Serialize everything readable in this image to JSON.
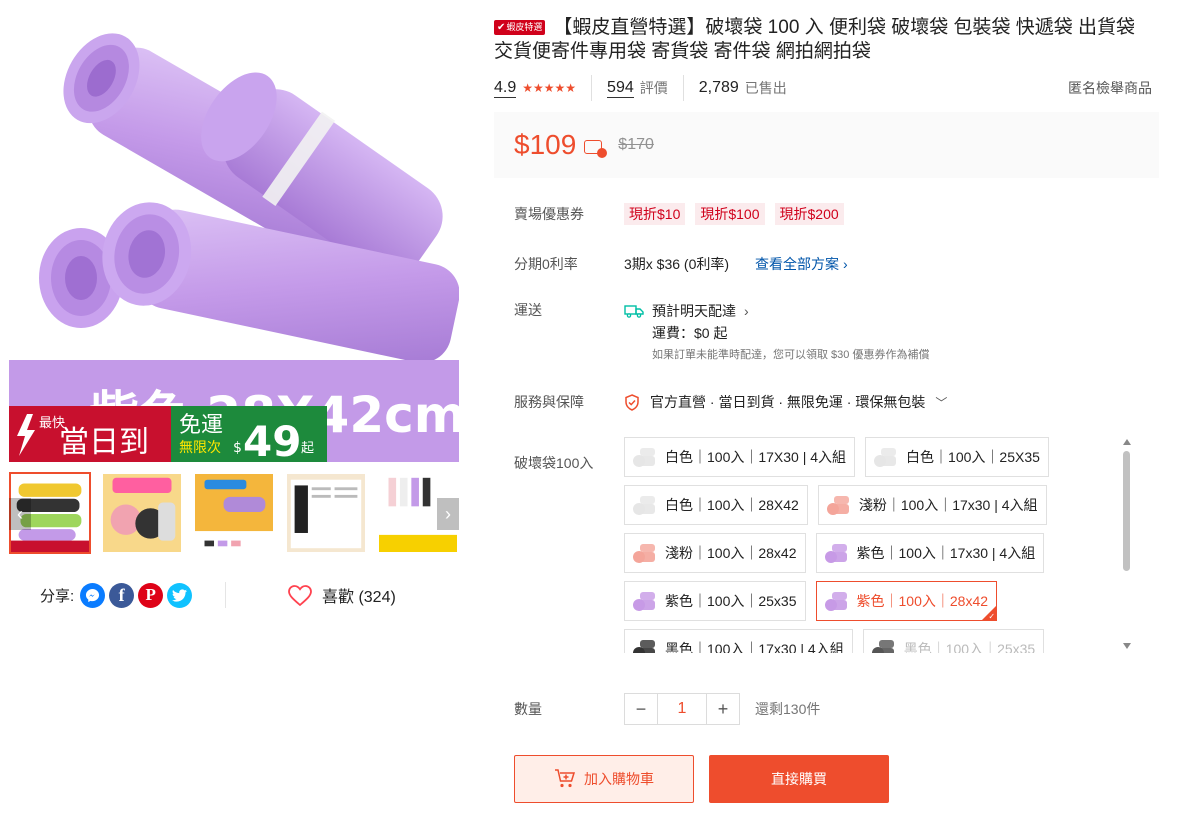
{
  "gallery": {
    "banner_text": "紫色 28X42cm",
    "badge_fastest": "最快",
    "badge_same_day": "當日到",
    "badge_free_ship": "免運",
    "badge_unlimited": "無限次",
    "badge_amount": "49",
    "badge_currency": "$",
    "badge_from": "起",
    "thumb_colors": [
      "#f0c830",
      "#e9a020",
      "#f4b63c",
      "#f5e7d0",
      "#f7d000"
    ],
    "prev_icon": "chevron-left-icon",
    "next_icon": "chevron-right-icon"
  },
  "share": {
    "label": "分享:",
    "icons": [
      "messenger-icon",
      "facebook-icon",
      "pinterest-icon",
      "twitter-icon"
    ]
  },
  "like": {
    "label": "喜歡 (324)",
    "icon": "heart-icon"
  },
  "product": {
    "tag": "蝦皮特選",
    "title": "【蝦皮直營特選】破壞袋 100 入 便利袋 破壞袋 包裝袋 快遞袋 出貨袋 交貨便寄件專用袋 寄貨袋 寄件袋 網拍網拍袋",
    "rating": "4.9",
    "stars": "★★★★★",
    "reviews_count": "594",
    "reviews_label": "評價",
    "sold_count": "2,789",
    "sold_label": "已售出",
    "report_label": "匿名檢舉商品"
  },
  "price": {
    "current": "$109",
    "original": "$170"
  },
  "vouchers": {
    "label": "賣場優惠券",
    "items": [
      "現折$10",
      "現折$100",
      "現折$200"
    ]
  },
  "installment": {
    "label": "分期0利率",
    "text": "3期x $36 (0利率)",
    "link": "查看全部方案"
  },
  "shipping": {
    "label": "運送",
    "eta": "預計明天配達",
    "fee": "運費：$0 起",
    "note": "如果訂單未能準時配達，您可以領取 $30 優惠券作為補償"
  },
  "service": {
    "label": "服務與保障",
    "text": "官方直營 · 當日到貨 · 無限免運 · 環保無包裝"
  },
  "variants": {
    "label": "破壞袋100入",
    "options": [
      {
        "label": "白色｜100入｜17X30 | 4入組",
        "color": "#e6e6e6"
      },
      {
        "label": "白色｜100入｜25X35",
        "color": "#e6e6e6"
      },
      {
        "label": "白色｜100入｜28X42",
        "color": "#e6e6e6"
      },
      {
        "label": "淺粉｜100入｜17x30 | 4入組",
        "color": "#f4a59a"
      },
      {
        "label": "淺粉｜100入｜28x42",
        "color": "#f4a59a"
      },
      {
        "label": "紫色｜100入｜17x30 | 4入組",
        "color": "#c79ae6"
      },
      {
        "label": "紫色｜100入｜25x35",
        "color": "#c79ae6"
      },
      {
        "label": "紫色｜100入｜28x42",
        "color": "#c79ae6"
      },
      {
        "label": "黑色｜100入｜17x30 | 4入組",
        "color": "#333333"
      },
      {
        "label": "黑色｜100入｜25x35",
        "color": "#555555"
      }
    ],
    "selected_index": 7
  },
  "quantity": {
    "label": "數量",
    "value": "1",
    "minus": "−",
    "plus": "+",
    "stock": "還剩130件"
  },
  "actions": {
    "add_to_cart": "加入購物車",
    "buy_now": "直接購買"
  },
  "colors": {
    "accent": "#ee4d2d",
    "product_purple": "#c39ae8"
  }
}
